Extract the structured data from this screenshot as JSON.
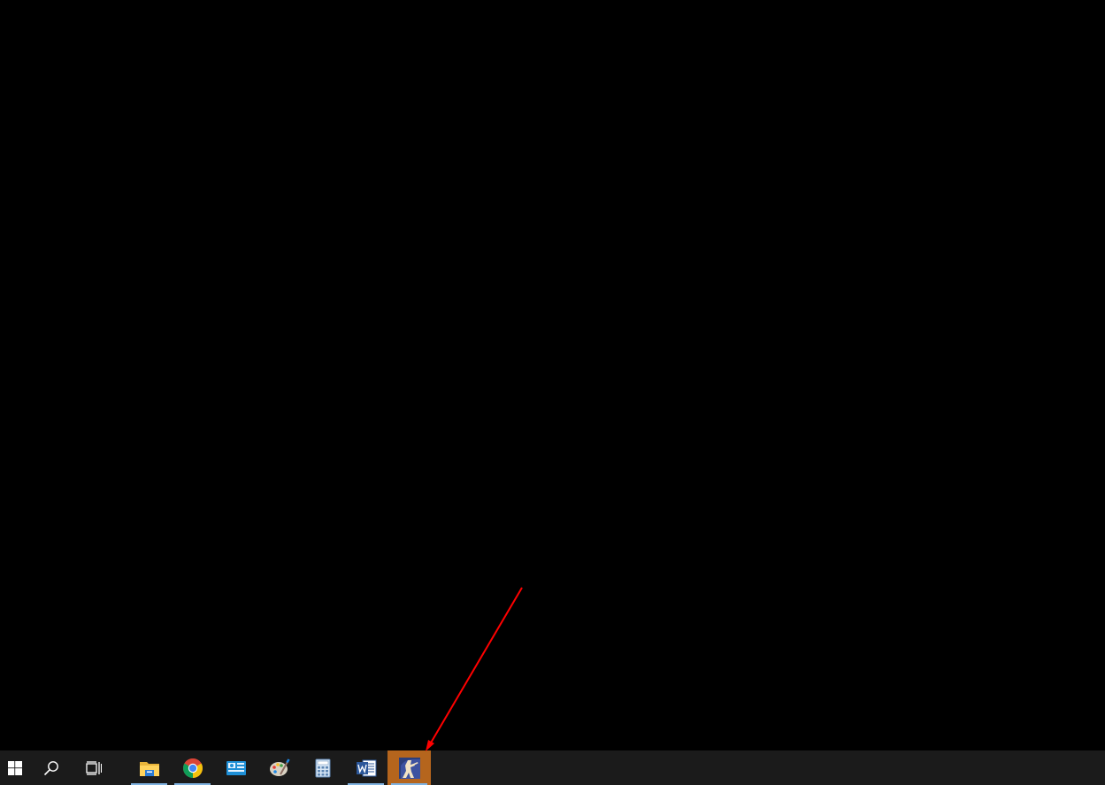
{
  "desktop": {
    "background_color": "#000000"
  },
  "annotation": {
    "type": "arrow",
    "color": "#ff0000",
    "points_to": "counter-strike-taskbar-button"
  },
  "taskbar": {
    "background_color": "#1b1b1b",
    "system_buttons": [
      {
        "name": "start-button",
        "icon": "windows-logo-icon"
      },
      {
        "name": "search-button",
        "icon": "search-icon"
      },
      {
        "name": "task-view-button",
        "icon": "task-view-icon"
      }
    ],
    "pinned_apps": [
      {
        "name": "file-explorer",
        "icon": "folder-icon",
        "running": true,
        "active": false
      },
      {
        "name": "google-chrome",
        "icon": "chrome-icon",
        "running": true,
        "active": false
      },
      {
        "name": "control-panel",
        "icon": "control-panel-icon",
        "running": false,
        "active": false
      },
      {
        "name": "paint",
        "icon": "paint-palette-icon",
        "running": false,
        "active": false
      },
      {
        "name": "calculator",
        "icon": "calculator-icon",
        "running": false,
        "active": false
      },
      {
        "name": "microsoft-word",
        "icon": "word-icon",
        "running": true,
        "active": false
      },
      {
        "name": "counter-strike",
        "icon": "counter-strike-icon",
        "running": true,
        "active": true
      }
    ],
    "active_color": "#b5651d",
    "running_indicator_color": "#7fb2e0"
  }
}
